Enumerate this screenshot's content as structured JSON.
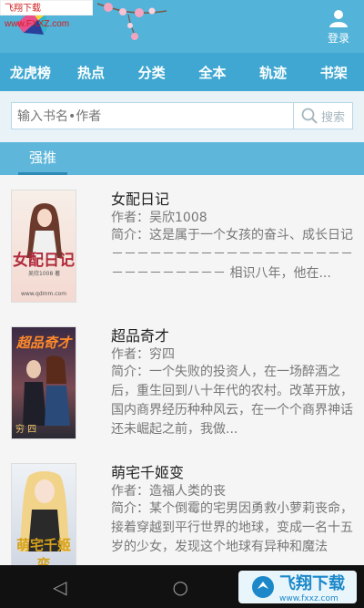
{
  "watermark_top": "飞翔下载 www.FXXZ.com",
  "header": {
    "login_label": "登录"
  },
  "nav": {
    "items": [
      "龙虎榜",
      "热点",
      "分类",
      "全本",
      "轨迹",
      "书架"
    ]
  },
  "search": {
    "placeholder": "输入书名•作者",
    "button_label": "搜索"
  },
  "section": {
    "tab_label": "强推"
  },
  "books": [
    {
      "title": "女配日记",
      "author": "作者：吴欣1008",
      "description": "简介：这是属于一个女孩的奋斗、成长日记 －－－－－－－－－－－－－－－－－－－－－－－－－－－－ 相识八年，他在...",
      "cover_text": "女配日记",
      "cover_author": "吴欣1008 著",
      "cover_site": "www.qdmm.com"
    },
    {
      "title": "超品奇才",
      "author": "作者：穷四",
      "description": "简介：一个失败的投资人，在一场醉酒之后，重生回到八十年代的农村。改革开放，国内商界经历种种风云，在一个个商界神话还未崛起之前，我做...",
      "cover_text": "超品奇才",
      "cover_author": "穷 四"
    },
    {
      "title": "萌宅千姬变",
      "author": "作者：造福人类的丧",
      "description": "简介：某个倒霉的宅男因勇救小萝莉丧命，接着穿越到平行世界的地球，变成一名十五岁的少女，发现这个地球有异种和魔法",
      "cover_text": "萌宅千姬变"
    }
  ],
  "watermark_bottom": {
    "main": "飞翔下载",
    "sub": "www.fxxz.com"
  }
}
